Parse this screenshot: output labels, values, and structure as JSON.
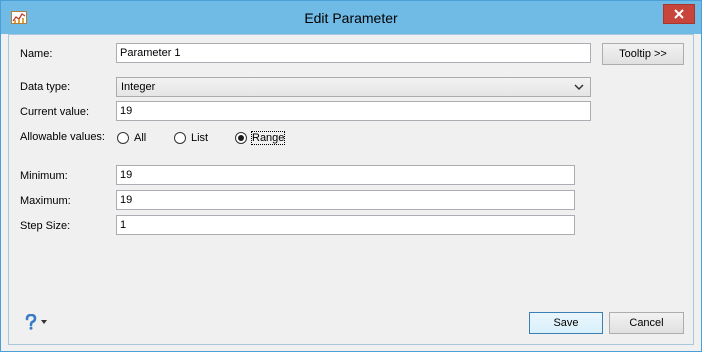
{
  "window": {
    "title": "Edit Parameter"
  },
  "fields": {
    "name_label": "Name:",
    "name_value": "Parameter 1",
    "tooltip_button": "Tooltip >>",
    "data_type_label": "Data type:",
    "data_type_value": "Integer",
    "current_value_label": "Current value:",
    "current_value": "19",
    "allowable_label": "Allowable values:",
    "allowable_options": [
      {
        "label": "All",
        "selected": false
      },
      {
        "label": "List",
        "selected": false
      },
      {
        "label": "Range",
        "selected": true
      }
    ],
    "minimum_label": "Minimum:",
    "minimum_value": "19",
    "maximum_label": "Maximum:",
    "maximum_value": "19",
    "step_label": "Step Size:",
    "step_value": "1"
  },
  "footer": {
    "help_icon": "question-mark-icon",
    "save_label": "Save",
    "cancel_label": "Cancel"
  },
  "colors": {
    "titlebar": "#6fbbe6",
    "close_button": "#c7453b",
    "help_icon": "#3a7bc8"
  }
}
